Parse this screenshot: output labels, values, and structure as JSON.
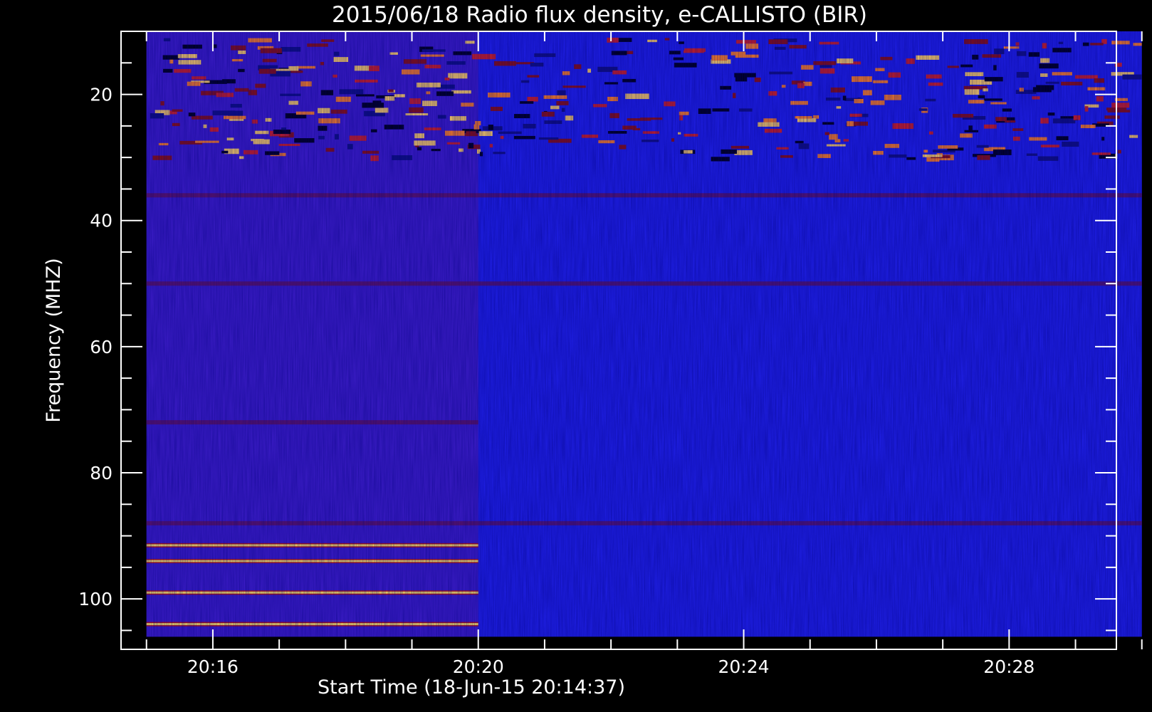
{
  "chart_data": {
    "type": "heatmap",
    "title": "2015/06/18  Radio flux density, e-CALLISTO (BIR)",
    "xlabel": "Start Time (18-Jun-15 20:14:37)",
    "ylabel": "Frequency (MHZ)",
    "x_ticks": [
      "20:16",
      "20:20",
      "20:24",
      "20:28"
    ],
    "y_ticks": [
      "20",
      "40",
      "60",
      "80",
      "100"
    ],
    "y_tick_values": [
      20,
      40,
      60,
      80,
      100
    ],
    "x_tick_values": [
      "20:16",
      "20:20",
      "20:24",
      "20:28"
    ],
    "x_range": [
      "20:14:37",
      "20:29:37"
    ],
    "data_time_range": [
      "20:15:00",
      "20:30:00"
    ],
    "y_range": [
      108,
      10
    ],
    "data_freq_range": [
      106,
      10
    ],
    "colormap": "red-temperature",
    "colors": {
      "background": "#000000",
      "dominant": "#2020e8",
      "hot_low": "#b01010",
      "hot_high": "#ffe060"
    },
    "features": [
      {
        "kind": "noise band",
        "freq_range": [
          11,
          30
        ]
      },
      {
        "kind": "bright band",
        "freq": 36
      },
      {
        "kind": "bright band",
        "freq": 50
      },
      {
        "kind": "bright band",
        "freq": 72,
        "time_range": [
          "20:15:00",
          "20:20:00"
        ]
      },
      {
        "kind": "bright band",
        "freq": 88
      },
      {
        "kind": "bright band",
        "freq": 91.5,
        "time_range": [
          "20:15:00",
          "20:20:00"
        ]
      },
      {
        "kind": "bright band",
        "freq": 94,
        "time_range": [
          "20:15:00",
          "20:20:00"
        ]
      },
      {
        "kind": "bright band",
        "freq": 99,
        "time_range": [
          "20:15:00",
          "20:20:00"
        ]
      },
      {
        "kind": "bright band",
        "freq": 104,
        "time_range": [
          "20:15:00",
          "20:20:00"
        ]
      }
    ]
  }
}
